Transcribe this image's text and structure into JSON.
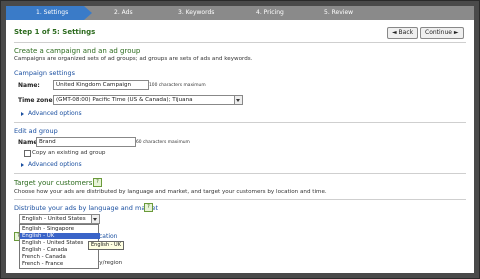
{
  "steps": [
    {
      "label": "1. Settings",
      "active": true
    },
    {
      "label": "2. Ads",
      "active": false
    },
    {
      "label": "3. Keywords",
      "active": false
    },
    {
      "label": "4. Pricing",
      "active": false
    },
    {
      "label": "5. Review",
      "active": false
    }
  ],
  "header": {
    "title": "Step 1 of 5:  Settings",
    "back_label": "Back",
    "continue_label": "Continue"
  },
  "create_section": {
    "heading": "Create a campaign and an ad group",
    "description": "Campaigns are organized sets of ad groups; ad groups are sets of ads and keywords."
  },
  "campaign_settings": {
    "heading": "Campaign settings",
    "name_label": "Name:",
    "name_value": "United Kingdom Campaign",
    "name_hint": "100 characters maximum",
    "timezone_label": "Time zone:",
    "timezone_value": "(GMT-08:00) Pacific Time (US & Canada); Tijuana",
    "advanced_label": "Advanced options"
  },
  "ad_group": {
    "heading": "Edit ad group",
    "name_label": "Name:",
    "name_value": "Brand",
    "name_hint": "60 characters maximum",
    "copy_label": "Copy an existing ad group",
    "advanced_label": "Advanced options"
  },
  "target": {
    "heading": "Target your customers",
    "description": "Choose how your ads are distributed by language and market, and target your customers by location and time.",
    "distribute_heading": "Distribute your ads by language and market",
    "selected_market": "English - United States",
    "options": [
      "English - Singapore",
      "English - UK",
      "English - United States",
      "English - Canada",
      "French - Canada",
      "French - France"
    ],
    "highlighted_index": 1,
    "tooltip": "English - UK",
    "partial_location_text": "cation",
    "partial_region_text": "ry/region"
  },
  "help_glyph": "?",
  "colors": {
    "active_step": "#3a7bc8",
    "heading_green": "#2c6b1e",
    "link_blue": "#1a4fa0",
    "highlight": "#3a64c8"
  }
}
